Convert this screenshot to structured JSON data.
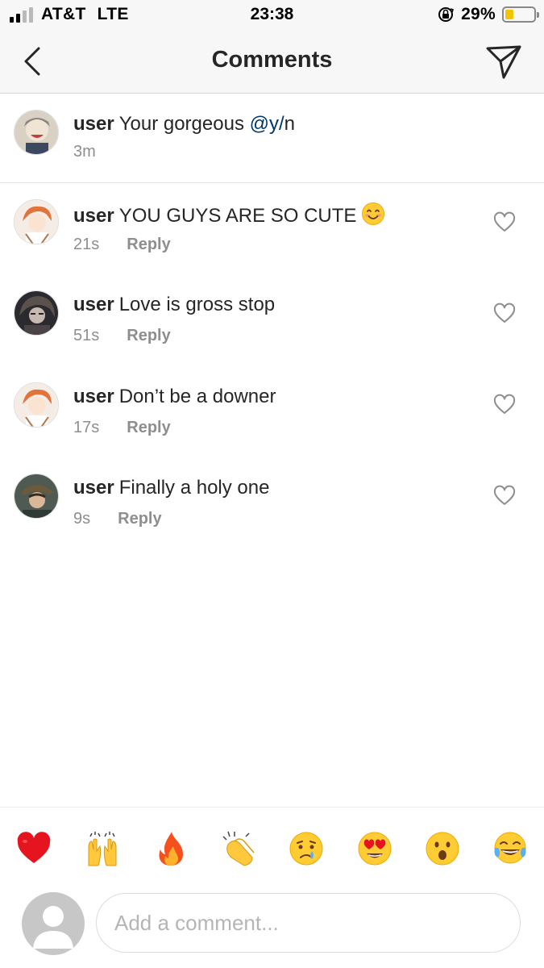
{
  "status_bar": {
    "carrier": "AT&T",
    "network": "LTE",
    "time": "23:38",
    "battery_percent": "29%",
    "battery_level": 0.29,
    "signal_bars_active": 2,
    "signal_bars_total": 4,
    "battery_fill_color": "#f5c400"
  },
  "header": {
    "title": "Comments",
    "back_icon": "chevron-left-icon",
    "send_icon": "paper-plane-icon"
  },
  "caption": {
    "username": "user",
    "text": "Your gorgeous",
    "mention": "@y/",
    "text_after": "n",
    "time": "3m"
  },
  "comments": [
    {
      "username": "user",
      "text": "YOU GUYS ARE SO CUTE",
      "emoji": "smiling-face-emoji",
      "time": "21s",
      "reply_label": "Reply"
    },
    {
      "username": "user",
      "text": "Love is gross stop",
      "time": "51s",
      "reply_label": "Reply"
    },
    {
      "username": "user",
      "text": "Don’t be a downer",
      "time": "17s",
      "reply_label": "Reply"
    },
    {
      "username": "user",
      "text": "Finally a holy one",
      "time": "9s",
      "reply_label": "Reply"
    }
  ],
  "emoji_bar": [
    "red-heart",
    "raising-hands",
    "fire",
    "clapping-hands",
    "crying-face",
    "heart-eyes-face",
    "surprised-face",
    "tears-of-joy-face"
  ],
  "input": {
    "placeholder": "Add a comment..."
  },
  "colors": {
    "text": "#262626",
    "secondary": "#8e8e8e",
    "mention": "#00376b",
    "header_bg": "#f7f7f7"
  }
}
